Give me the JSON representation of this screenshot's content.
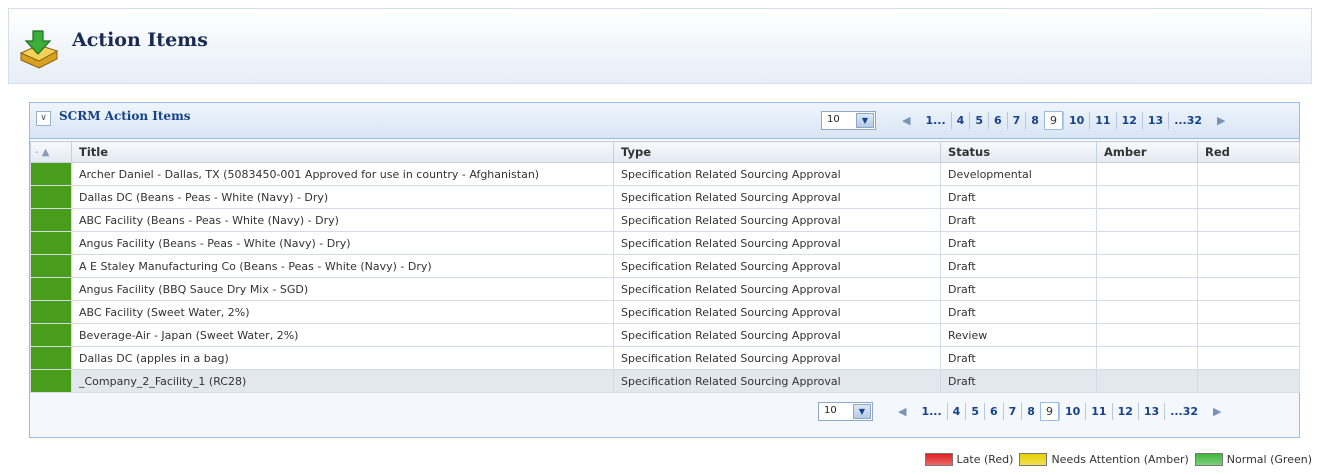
{
  "page": {
    "title": "Action Items",
    "icon": "download-box-icon"
  },
  "panel": {
    "title": "SCRM Action Items",
    "page_size": "10",
    "pager": {
      "prev": "◀",
      "next": "▶",
      "pages": [
        "1...",
        "4",
        "5",
        "6",
        "7",
        "8",
        "9",
        "10",
        "11",
        "12",
        "13",
        "...32"
      ],
      "current": "9"
    }
  },
  "grid": {
    "columns": [
      "- ▲",
      "Title",
      "Type",
      "Status",
      "Amber",
      "Red"
    ],
    "rows": [
      {
        "title": "Archer Daniel - Dallas, TX (5083450-001 Approved for use in country - Afghanistan)",
        "type": "Specification Related Sourcing Approval",
        "status": "Developmental",
        "amber": "",
        "red": ""
      },
      {
        "title": "Dallas DC (Beans - Peas - White (Navy) - Dry)",
        "type": "Specification Related Sourcing Approval",
        "status": "Draft",
        "amber": "",
        "red": ""
      },
      {
        "title": "ABC Facility (Beans - Peas - White (Navy) - Dry)",
        "type": "Specification Related Sourcing Approval",
        "status": "Draft",
        "amber": "",
        "red": ""
      },
      {
        "title": "Angus Facility (Beans - Peas - White (Navy) - Dry)",
        "type": "Specification Related Sourcing Approval",
        "status": "Draft",
        "amber": "",
        "red": ""
      },
      {
        "title": "A E Staley Manufacturing Co (Beans - Peas - White (Navy) - Dry)",
        "type": "Specification Related Sourcing Approval",
        "status": "Draft",
        "amber": "",
        "red": ""
      },
      {
        "title": "Angus Facility (BBQ Sauce Dry Mix - SGD)",
        "type": "Specification Related Sourcing Approval",
        "status": "Draft",
        "amber": "",
        "red": ""
      },
      {
        "title": "ABC Facility (Sweet Water, 2%)",
        "type": "Specification Related Sourcing Approval",
        "status": "Draft",
        "amber": "",
        "red": ""
      },
      {
        "title": "Beverage-Air - Japan (Sweet Water, 2%)",
        "type": "Specification Related Sourcing Approval",
        "status": "Review",
        "amber": "",
        "red": ""
      },
      {
        "title": "Dallas DC (apples in a bag)",
        "type": "Specification Related Sourcing Approval",
        "status": "Draft",
        "amber": "",
        "red": ""
      },
      {
        "title": "_Company_2_Facility_1 (RC28)",
        "type": "Specification Related Sourcing Approval",
        "status": "Draft",
        "amber": "",
        "red": ""
      }
    ],
    "selected_row": 9,
    "indicator_color": "#4a9d1a"
  },
  "legend": [
    {
      "label": "Late (Red)",
      "color": "#e02020"
    },
    {
      "label": "Needs Attention (Amber)",
      "color": "#e8d000"
    },
    {
      "label": "Normal (Green)",
      "color": "#3fb83a"
    }
  ]
}
